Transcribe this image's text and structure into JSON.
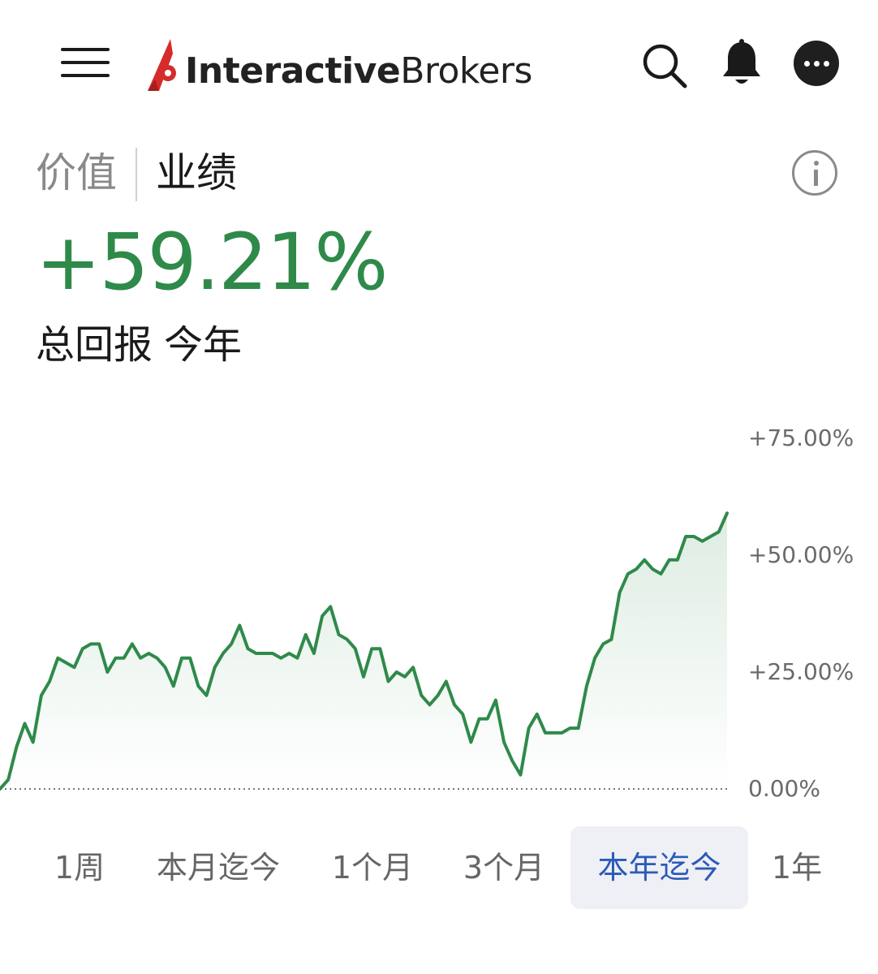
{
  "header": {
    "logo": {
      "text_bold": "Interactive",
      "text_light": "Brokers",
      "brand_color": "#d62b2b"
    },
    "icons": [
      "menu-icon",
      "search-icon",
      "bell-icon",
      "more-icon"
    ]
  },
  "tabs": [
    {
      "label": "价值",
      "active": false
    },
    {
      "label": "业绩",
      "active": true
    }
  ],
  "performance": {
    "total_return": "+59.21%",
    "label_prefix": "总回报",
    "label_period": "今年",
    "color": "#2f8a4a"
  },
  "chart_data": {
    "type": "area",
    "y_unit": "%",
    "ylim": [
      0,
      75
    ],
    "y_ticks": [
      {
        "value": 75,
        "label": "+75.00%"
      },
      {
        "value": 50,
        "label": "+50.00%"
      },
      {
        "value": 25,
        "label": "+25.00%"
      },
      {
        "value": 0,
        "label": "0.00%"
      }
    ],
    "baseline_value": 0,
    "line_color": "#2f8a4a",
    "fill_color": "#2f8a4a",
    "series": [
      {
        "values": [
          0,
          2,
          9,
          14,
          10,
          20,
          23,
          28,
          27,
          26,
          30,
          31,
          31,
          25,
          28,
          28,
          31,
          28,
          29,
          28,
          26,
          22,
          28,
          28,
          22,
          20,
          26,
          29,
          31,
          35,
          30,
          29,
          29,
          29,
          28,
          29,
          28,
          33,
          29,
          37,
          39,
          33,
          32,
          30,
          24,
          30,
          30,
          23,
          25,
          24,
          26,
          20,
          18,
          20,
          23,
          18,
          16,
          10,
          15,
          15,
          19,
          10,
          6,
          3,
          13,
          16,
          12,
          12,
          12,
          13,
          13,
          22,
          28,
          31,
          32,
          42,
          46,
          47,
          49,
          47,
          46,
          49,
          49,
          54,
          54,
          53,
          54,
          55,
          59
        ]
      }
    ]
  },
  "ranges": [
    {
      "label": "1周",
      "active": false
    },
    {
      "label": "本月迄今",
      "active": false
    },
    {
      "label": "1个月",
      "active": false
    },
    {
      "label": "3个月",
      "active": false
    },
    {
      "label": "本年迄今",
      "active": true
    },
    {
      "label": "1年",
      "active": false
    }
  ]
}
